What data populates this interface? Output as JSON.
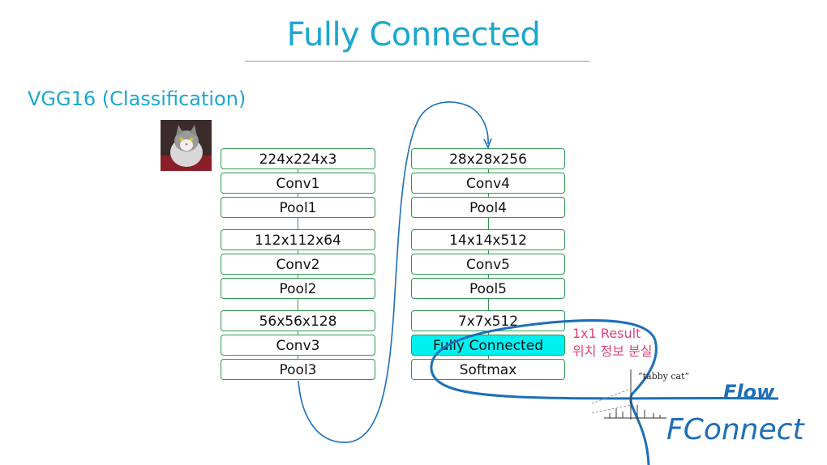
{
  "slide": {
    "title": "Fully Connected",
    "subtitle": "VGG16 (Classification)"
  },
  "left_column": [
    [
      "224x224x3",
      "Conv1",
      "Pool1"
    ],
    [
      "112x112x64",
      "Conv2",
      "Pool2"
    ],
    [
      "56x56x128",
      "Conv3",
      "Pool3"
    ]
  ],
  "right_column": [
    [
      "28x28x256",
      "Conv4",
      "Pool4"
    ],
    [
      "14x14x512",
      "Conv5",
      "Pool5"
    ],
    [
      "7x7x512",
      "Fully Connected",
      "Softmax"
    ]
  ],
  "highlighted_layer": "Fully Connected",
  "annotation": {
    "line1": "1x1 Result",
    "line2": "위치 정보 분실"
  },
  "output_label": "“tabby cat”",
  "handwriting": {
    "line1": "Flow",
    "line2": "FConnect"
  },
  "colors": {
    "title": "#1ba7cf",
    "layer_border": "#2e9a50",
    "highlight": "#00f0f0",
    "annotation": "#e0427a",
    "pen_ink": "#1e6fb8"
  }
}
